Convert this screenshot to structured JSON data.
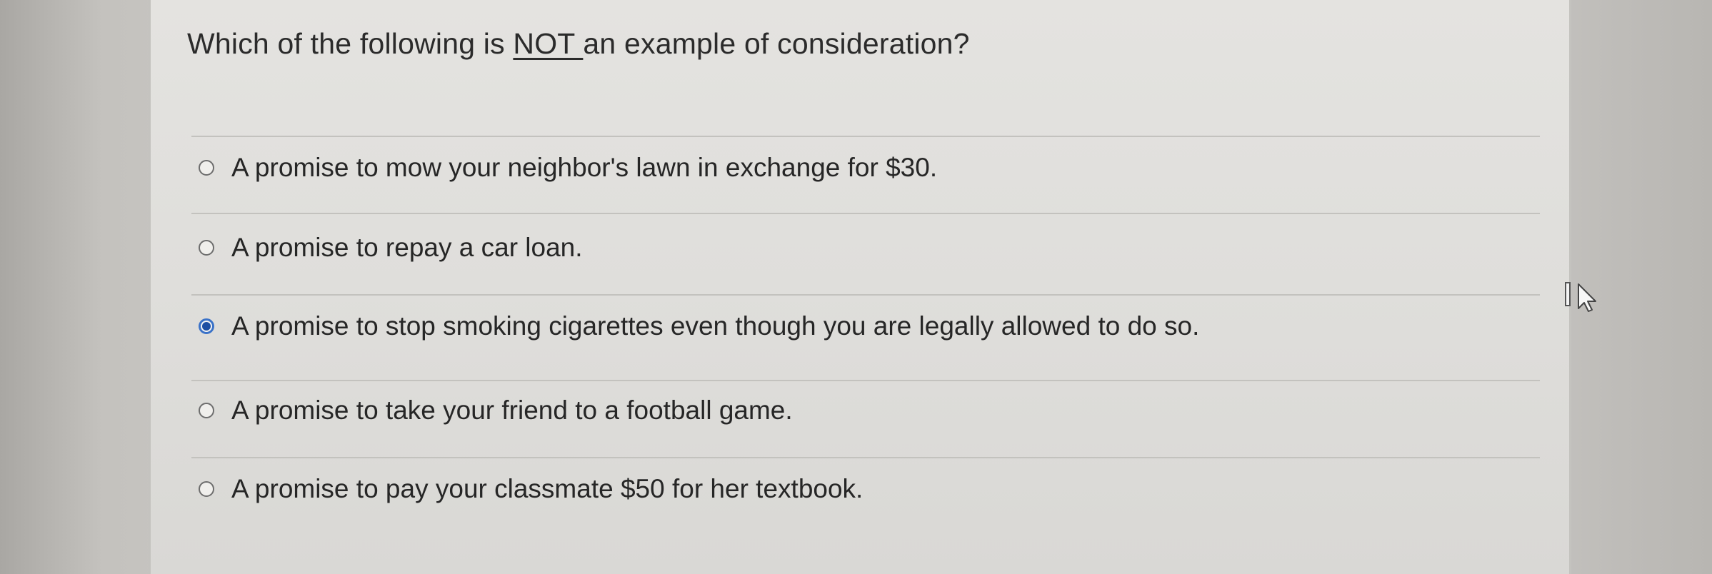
{
  "question": {
    "prefix": "Which of the following is ",
    "emphasis": "NOT ",
    "suffix": "an example of consideration?"
  },
  "options": [
    {
      "label": "A promise to mow your neighbor's lawn in exchange for $30.",
      "selected": false
    },
    {
      "label": "A promise to repay a car loan.",
      "selected": false
    },
    {
      "label": "A promise to stop smoking cigarettes even though you are legally allowed to do so.",
      "selected": true
    },
    {
      "label": "A promise to take your friend to a football game.",
      "selected": false
    },
    {
      "label": "A promise to pay your classmate $50 for her textbook.",
      "selected": false
    }
  ],
  "colors": {
    "selected_radio": "#1d4fa3",
    "text": "#262626"
  },
  "icons": {
    "cursor": "move-cursor-icon"
  }
}
